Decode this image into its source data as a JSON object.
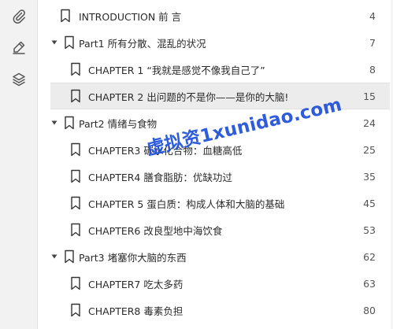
{
  "rail": {
    "icons": [
      "paperclip-icon",
      "pen-icon",
      "layers-icon"
    ]
  },
  "toc": {
    "items": [
      {
        "level": 1,
        "caret": false,
        "label": "INTRODUCTION 前 言",
        "page": "4"
      },
      {
        "level": 0,
        "caret": true,
        "label": "Part1 所有分散、混乱的状况",
        "page": "7"
      },
      {
        "level": 1,
        "caret": false,
        "label": "CHAPTER 1 “我就是感觉不像我自己了”",
        "page": "8"
      },
      {
        "level": 1,
        "caret": false,
        "label": "CHAPTER 2 出问题的不是你——是你的大脑!",
        "page": "15",
        "selected": true
      },
      {
        "level": 0,
        "caret": true,
        "label": "Part2 情绪与食物",
        "page": "24"
      },
      {
        "level": 1,
        "caret": false,
        "label": "CHAPTER3 碳水化合物：血糖高低",
        "page": "25"
      },
      {
        "level": 1,
        "caret": false,
        "label": "CHAPTER4 膳食脂肪：优缺功过",
        "page": "35"
      },
      {
        "level": 1,
        "caret": false,
        "label": "CHAPTER 5 蛋白质：构成人体和大脑的基础",
        "page": "45"
      },
      {
        "level": 1,
        "caret": false,
        "label": "CHAPTER6 改良型地中海饮食",
        "page": "53"
      },
      {
        "level": 0,
        "caret": true,
        "label": "Part3 堵塞你大脑的东西",
        "page": "62"
      },
      {
        "level": 1,
        "caret": false,
        "label": "CHAPTER7 吃太多药",
        "page": "63"
      },
      {
        "level": 1,
        "caret": false,
        "label": "CHAPTER8 毒素负担",
        "page": "80"
      }
    ]
  },
  "watermark": "虚拟资1xunidao.com",
  "colors": {
    "watermark": "#1d4fd8",
    "selected_row": "#ececec",
    "text": "#2a2a2a"
  }
}
